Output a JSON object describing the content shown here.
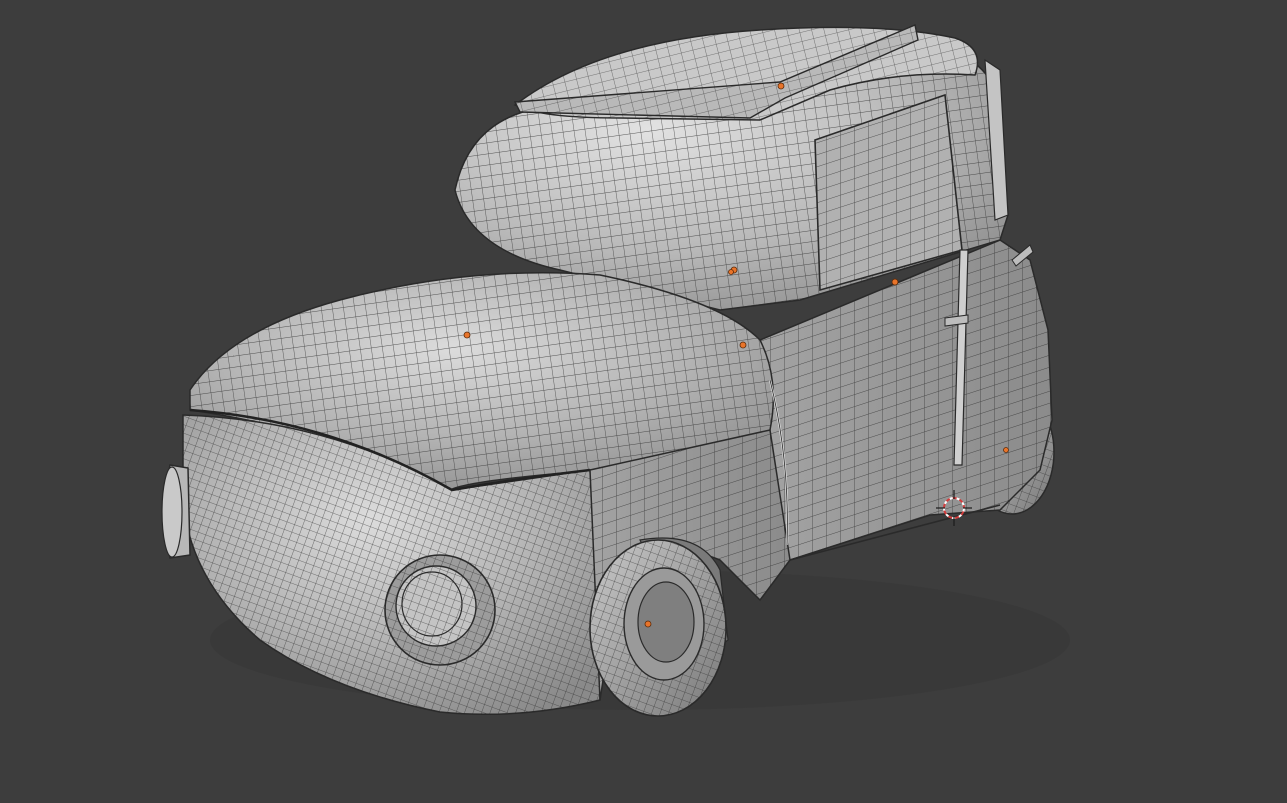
{
  "viewport": {
    "background_color": "#3d3d3d",
    "mesh_base_color": "#a9a9a9",
    "mesh_highlight_color": "#d9d9d9",
    "mesh_shadow_color": "#5c5c5c",
    "wireframe_color": "#2a2a2a",
    "origin_point_color": "#e8742a",
    "cursor_color_primary": "#d23b3b",
    "cursor_color_secondary": "#ffffff"
  },
  "scene": {
    "object": "car-mesh",
    "shading": "solid-wireframe-overlay",
    "icons": [
      "3d-cursor-icon",
      "object-origin-icon"
    ]
  }
}
